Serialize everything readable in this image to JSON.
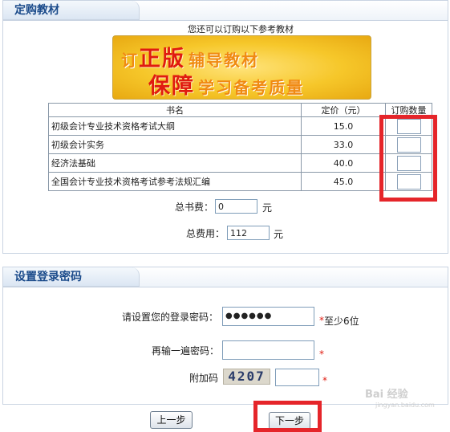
{
  "order_section": {
    "title": "定购教材",
    "intro": "您还可以订购以下参考教材",
    "banner": {
      "line1_red": "订",
      "line1_red_big": "正版",
      "line1_orange": "辅导教材",
      "line2_red_big": "保障",
      "line2_orange": "学习备考质量"
    },
    "table": {
      "headers": [
        "书名",
        "定价（元）",
        "订购数量"
      ],
      "rows": [
        {
          "name": "初级会计专业技术资格考试大纲",
          "price": "15.0"
        },
        {
          "name": "初级会计实务",
          "price": "33.0"
        },
        {
          "name": "经济法基础",
          "price": "40.0"
        },
        {
          "name": "全国会计专业技术资格考试参考法规汇编",
          "price": "45.0"
        }
      ]
    },
    "book_fee_label": "总书费：",
    "book_fee_value": "0",
    "total_fee_label": "总费用：",
    "total_fee_value": "112",
    "unit": "元"
  },
  "password_section": {
    "title": "设置登录密码",
    "password_label": "请设置您的登录密码：",
    "password_value": "●●●●●●",
    "password_hint": "至少6位",
    "confirm_label": "再输一遍密码：",
    "captcha_label": "附加码",
    "captcha_text": "4207",
    "required_mark": "*"
  },
  "buttons": {
    "prev": "上一步",
    "next": "下一步"
  },
  "watermark": {
    "main": "Bai 经验",
    "sub": "jingyan.baidu.com"
  },
  "colors": {
    "title_blue": "#1a4a8a",
    "highlight_red": "#e5252a",
    "banner_yellow": "#f6c72a"
  }
}
